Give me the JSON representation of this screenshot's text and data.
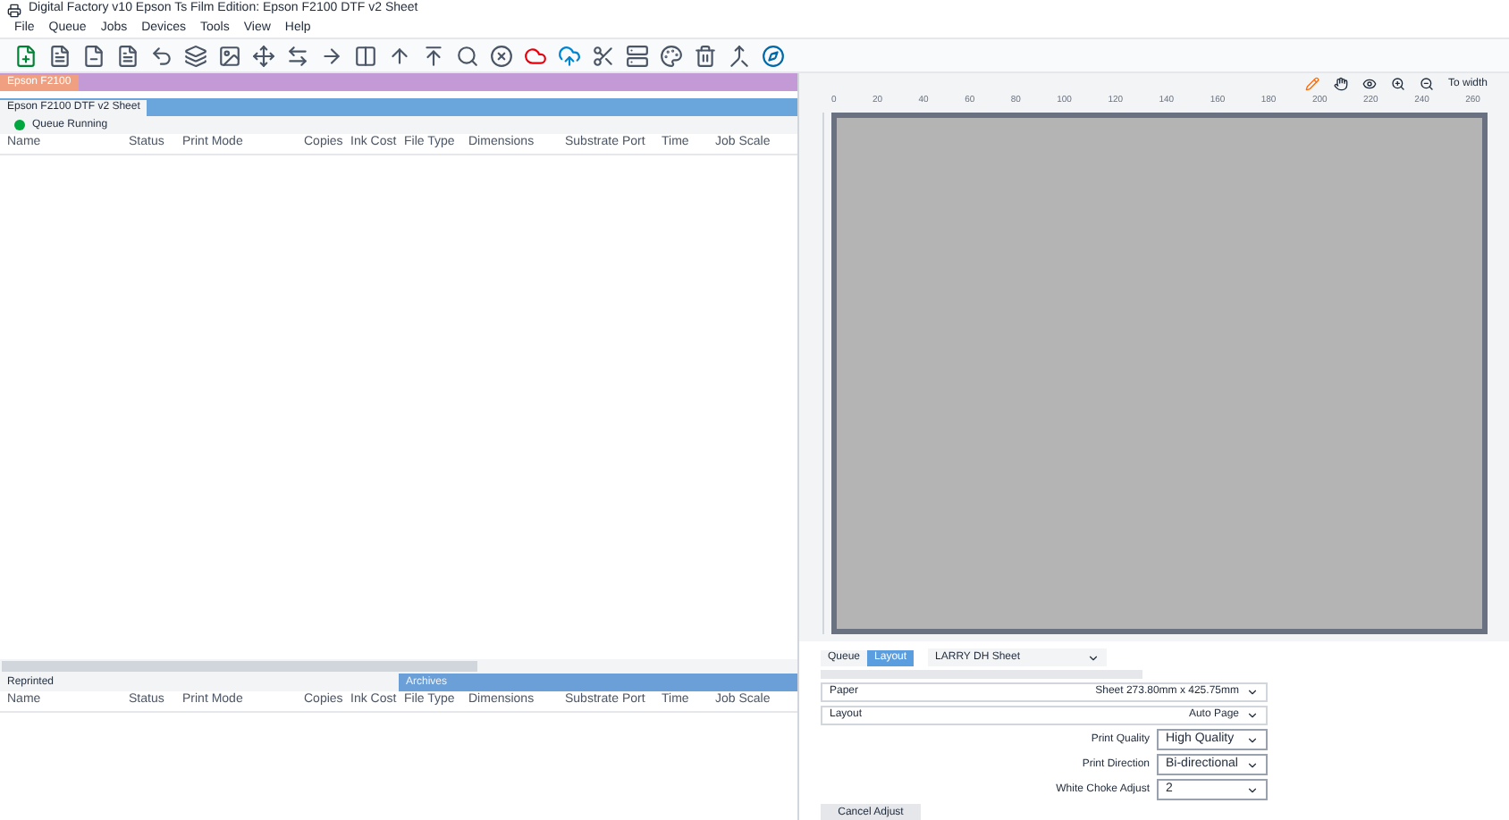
{
  "window": {
    "title": "Digital Factory v10 Epson Ts Film Edition: Epson F2100 DTF v2 Sheet"
  },
  "menu": [
    "File",
    "Queue",
    "Jobs",
    "Devices",
    "Tools",
    "View",
    "Help"
  ],
  "printer": {
    "name": "Epson F2100"
  },
  "queue": {
    "name": "Epson F2100 DTF v2 Sheet",
    "status": "Queue Running"
  },
  "columns": [
    "Name",
    "Status",
    "Print Mode",
    "Copies",
    "Ink Cost",
    "File Type",
    "Dimensions",
    "Substrate",
    "Port",
    "Time",
    "Job Scale"
  ],
  "bottom_tabs": [
    {
      "label": "Reprinted",
      "selected": false
    },
    {
      "label": "Archives",
      "selected": true
    }
  ],
  "bottom_columns": [
    "Name",
    "Status",
    "Print Mode",
    "Copies",
    "Ink Cost",
    "File Type",
    "Dimensions",
    "Substrate",
    "Port",
    "Time",
    "Job Scale"
  ],
  "preview": {
    "zoom_label": "To width",
    "ruler": [
      "0",
      "20",
      "40",
      "60",
      "80",
      "100",
      "120",
      "140",
      "160",
      "180",
      "200",
      "220",
      "240",
      "260"
    ]
  },
  "settings": {
    "tabs": [
      {
        "label": "Queue",
        "selected": false
      },
      {
        "label": "Layout",
        "selected": true
      }
    ],
    "sheet_select": "LARRY DH Sheet",
    "paper": {
      "label": "Paper",
      "value": "Sheet 273.80mm x 425.75mm"
    },
    "layout": {
      "label": "Layout",
      "value": "Auto Page"
    },
    "rows": [
      {
        "label": "Print Quality",
        "value": "High Quality"
      },
      {
        "label": "Print Direction",
        "value": "Bi-directional"
      },
      {
        "label": "White Choke Adjust",
        "value": "2"
      }
    ],
    "button": "Cancel Adjust"
  }
}
